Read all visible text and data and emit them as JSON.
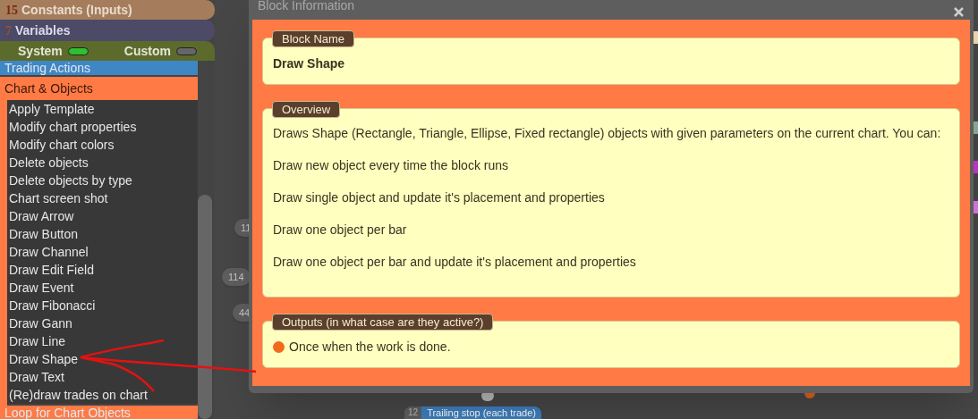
{
  "constants": {
    "count": "15",
    "label": "Constants (Inputs)"
  },
  "variables": {
    "count": "7",
    "label": "Variables"
  },
  "toggles": [
    {
      "label": "System",
      "on": true
    },
    {
      "label": "Custom",
      "on": false
    }
  ],
  "categories": [
    {
      "label": "Trading Actions",
      "color": "#3f86c4",
      "expanded": false
    },
    {
      "label": "Chart & Objects",
      "color": "#ff7a45",
      "expanded": true,
      "items": [
        "Apply Template",
        "Modify chart properties",
        "Modify chart colors",
        "Delete objects",
        "Delete objects by type",
        "Chart screen shot",
        "Draw Arrow",
        "Draw Button",
        "Draw Channel",
        "Draw Edit Field",
        "Draw Event",
        "Draw Fibonacci",
        "Draw Gann",
        "Draw Line",
        "Draw Shape",
        "Draw Text",
        "(Re)draw trades on chart"
      ]
    },
    {
      "label": "Loop for Chart Objects",
      "color": "#ff7a45",
      "expanded": false
    }
  ],
  "canvas_nodes": [
    {
      "badge": "11"
    },
    {
      "badge": "114"
    },
    {
      "badge": "44"
    },
    {
      "badge": "12",
      "label": "Trailing stop (each trade)"
    }
  ],
  "dialog": {
    "title": "Block Information",
    "sections": [
      {
        "kind": "name",
        "heading": "Block Name",
        "text": "Draw Shape"
      },
      {
        "kind": "paragraphs",
        "heading": "Overview",
        "paragraphs": [
          "Draws Shape (Rectangle, Triangle, Ellipse, Fixed rectangle) objects with given parameters on the current chart. You can:",
          "Draw new object every time the block runs",
          "Draw single object and update it's placement and properties",
          "Draw one object per bar",
          "Draw one object per bar and update it's placement and properties"
        ]
      },
      {
        "kind": "outputs",
        "heading": "Outputs (in what case are they active?)",
        "outputs": [
          {
            "text": "Once when the work is done.",
            "color": "#f26a1b"
          }
        ]
      }
    ]
  }
}
